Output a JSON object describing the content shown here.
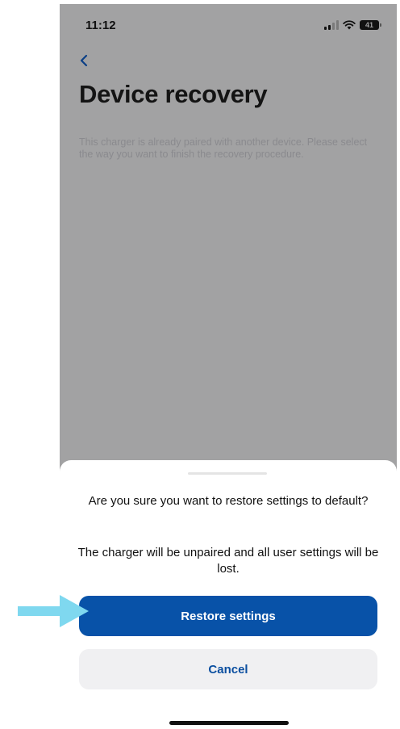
{
  "status_bar": {
    "time": "11:12",
    "battery_level": "41"
  },
  "page": {
    "title": "Device recovery",
    "description": "This charger is already paired with another device. Please select the way you want to finish the recovery procedure."
  },
  "dialog": {
    "title": "Are you sure you want to restore settings to default?",
    "message": "The charger will be unpaired and all user settings will be lost.",
    "primary_label": "Restore settings",
    "secondary_label": "Cancel"
  },
  "colors": {
    "primary": "#0852a8",
    "overlay": "#a2a2a3",
    "annotation_arrow": "#7fd8ef"
  },
  "icons": {
    "back": "chevron-left-icon",
    "signal": "cellular-signal-icon",
    "wifi": "wifi-icon",
    "battery": "battery-icon",
    "annotation": "pointer-arrow-icon"
  }
}
